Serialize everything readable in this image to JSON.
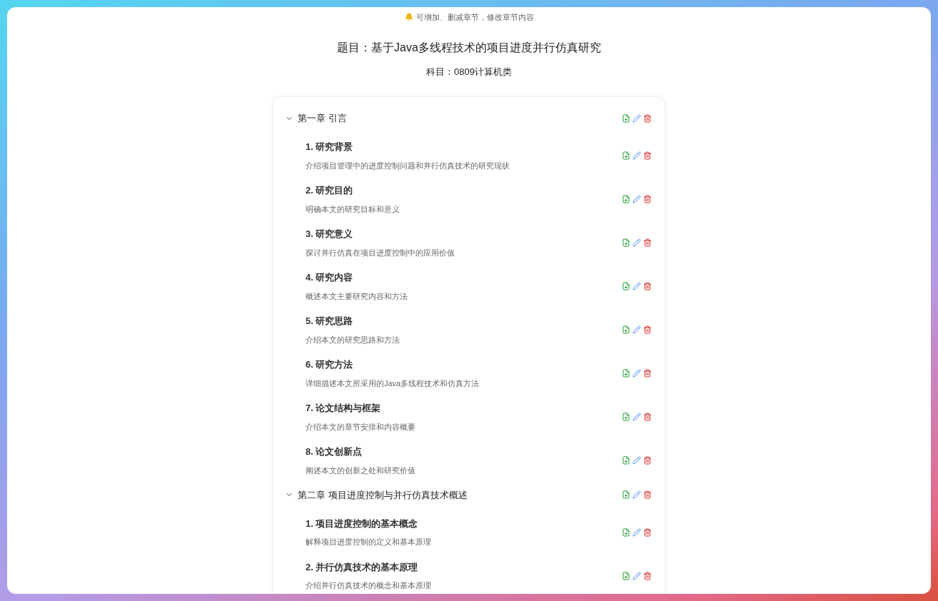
{
  "notice": "可增加、删减章节，修改章节内容",
  "title": "题目：基于Java多线程技术的项目进度并行仿真研究",
  "subject": "科目：0809计算机类",
  "chapters": [
    {
      "title": "第一章 引言",
      "expanded": true,
      "sections": [
        {
          "title": "1. 研究背景",
          "description": "介绍项目管理中的进度控制问题和并行仿真技术的研究现状"
        },
        {
          "title": "2. 研究目的",
          "description": "明确本文的研究目标和意义"
        },
        {
          "title": "3. 研究意义",
          "description": "探讨并行仿真在项目进度控制中的应用价值"
        },
        {
          "title": "4. 研究内容",
          "description": "概述本文主要研究内容和方法"
        },
        {
          "title": "5. 研究思路",
          "description": "介绍本文的研究思路和方法"
        },
        {
          "title": "6. 研究方法",
          "description": "详细描述本文所采用的Java多线程技术和仿真方法"
        },
        {
          "title": "7. 论文结构与框架",
          "description": "介绍本文的章节安排和内容概要"
        },
        {
          "title": "8. 论文创新点",
          "description": "阐述本文的创新之处和研究价值"
        }
      ]
    },
    {
      "title": "第二章 项目进度控制与并行仿真技术概述",
      "expanded": true,
      "sections": [
        {
          "title": "1. 项目进度控制的基本概念",
          "description": "解释项目进度控制的定义和基本原理"
        },
        {
          "title": "2. 并行仿真技术的基本原理",
          "description": "介绍并行仿真技术的概念和基本原理"
        }
      ]
    }
  ]
}
